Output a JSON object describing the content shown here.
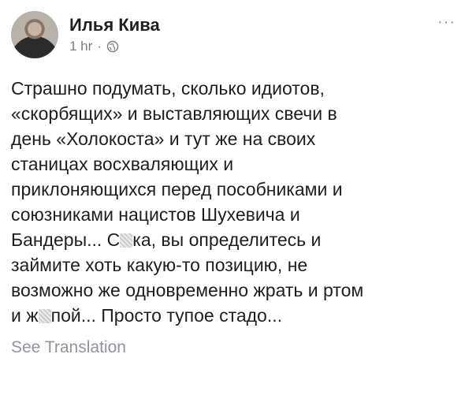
{
  "post": {
    "author": "Илья Кива",
    "time": "1 hr",
    "separator": "·",
    "privacy_icon": "globe-icon",
    "more_label": "···",
    "body_lines": [
      "Страшно подумать, сколько идиотов,",
      "«скорбящих» и выставляющих свечи в",
      "день «Холокоста» и тут же на своих",
      "станицах восхваляющих и",
      "приклоняющихся перед пособниками и",
      "союзниками нацистов Шухевича и"
    ],
    "line7_before": "Бандеры... С",
    "line7_after": "ка, вы определитесь и",
    "line8": "займите хоть какую-то позицию, не",
    "line9": "возможно же одновременно жрать и ртом",
    "line10_before": "и ж",
    "line10_after": "пой... Просто тупое стадо...",
    "see_translation": "See Translation"
  }
}
